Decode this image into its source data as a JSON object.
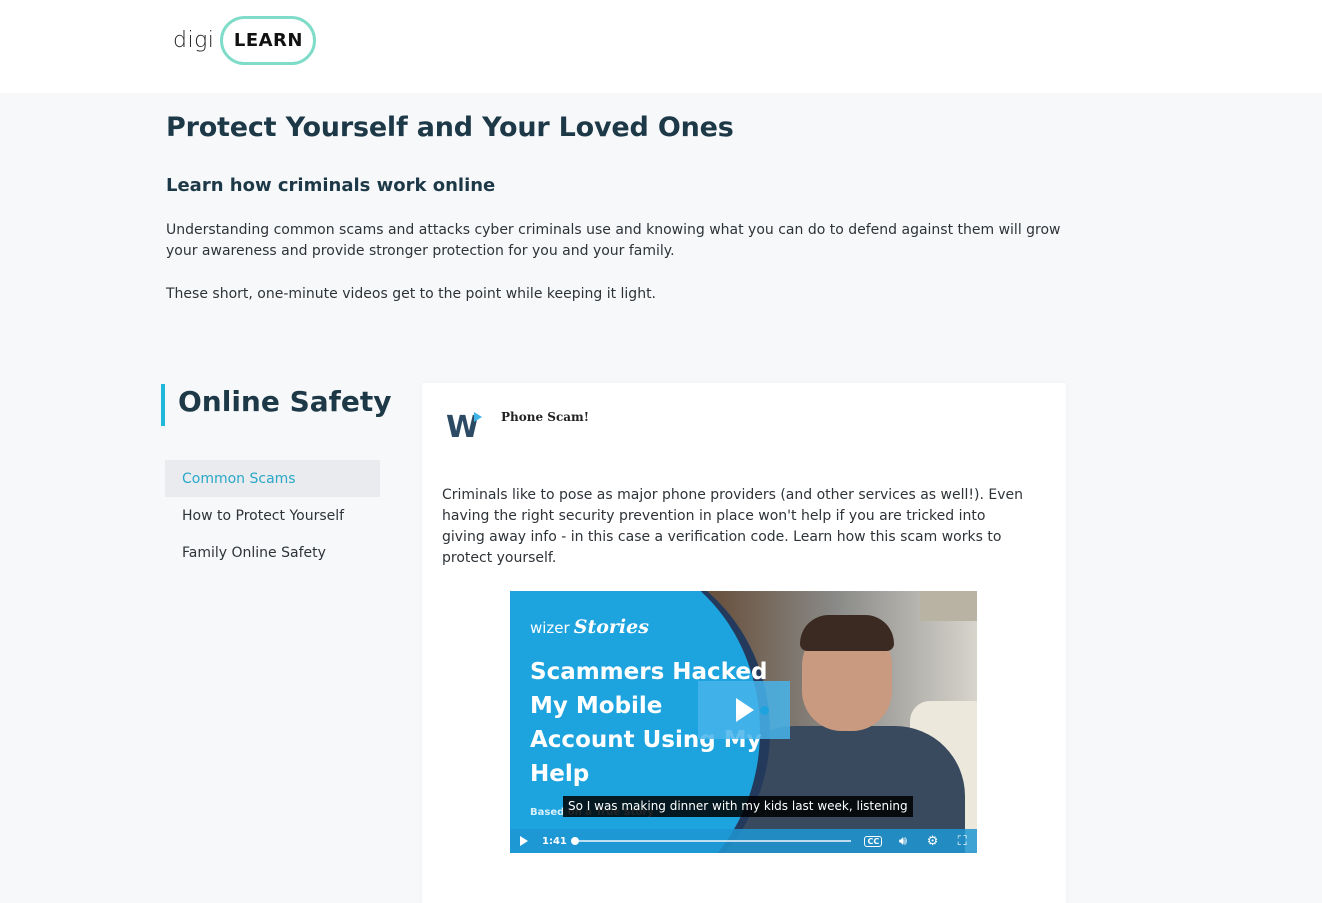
{
  "header": {
    "logo_digi": "digi",
    "logo_learn": "LEARN"
  },
  "page": {
    "title": "Protect Yourself and Your Loved Ones",
    "subtitle": "Learn how criminals work online",
    "intro": "Understanding common scams and attacks cyber criminals use and knowing what you can do to defend against them will grow your awareness and provide stronger protection for you and your family.",
    "intro2": "These short, one-minute videos get to the point while keeping it light."
  },
  "section": {
    "title": "Online Safety",
    "accent_color": "#1fb8d8"
  },
  "sidebar": {
    "items": [
      {
        "label": "Common Scams",
        "active": true
      },
      {
        "label": "How to Protect Yourself",
        "active": false
      },
      {
        "label": "Family Online Safety",
        "active": false
      }
    ]
  },
  "card": {
    "logo_icon": "wizer-logo-icon",
    "heading": "Phone Scam!",
    "description": "Criminals like to pose as major phone providers (and other services as well!). Even having the right security prevention in place won't help if you are tricked into giving away info - in this case a verification code. Learn how this scam works to protect yourself."
  },
  "video": {
    "brand": "wizer",
    "brand_stories": "Stories",
    "headline": "Scammers Hacked My Mobile Account Using My Help",
    "based_on": "Based on a True Story",
    "caption": "So I was making dinner with my kids last week, listening",
    "time": "1:41",
    "cc_label": "CC",
    "progress": 0.0,
    "brand_color": "#1da3dd"
  }
}
